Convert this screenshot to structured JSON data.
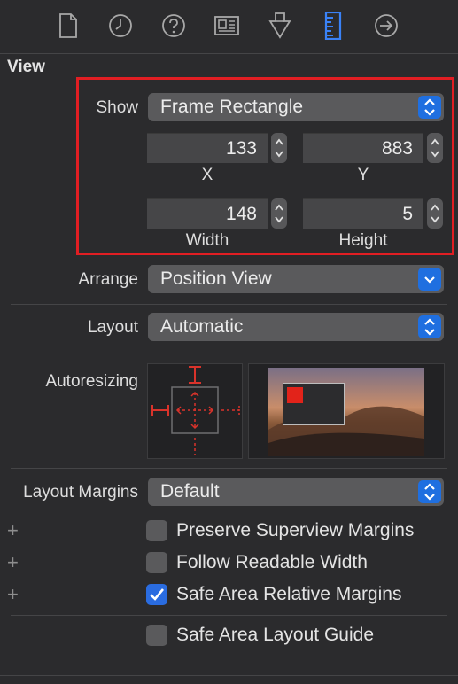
{
  "toolbar": {
    "icons": [
      "file-icon",
      "clock-icon",
      "help-icon",
      "identity-icon",
      "attributes-icon",
      "ruler-icon",
      "connections-icon"
    ],
    "active_color": "#3a82f7"
  },
  "section": {
    "title": "View"
  },
  "show": {
    "label": "Show",
    "value": "Frame Rectangle"
  },
  "frame": {
    "x": {
      "value": "133",
      "caption": "X"
    },
    "y": {
      "value": "883",
      "caption": "Y"
    },
    "width": {
      "value": "148",
      "caption": "Width"
    },
    "height": {
      "value": "5",
      "caption": "Height"
    }
  },
  "arrange": {
    "label": "Arrange",
    "value": "Position View"
  },
  "layout": {
    "label": "Layout",
    "value": "Automatic"
  },
  "autoresizing": {
    "label": "Autoresizing",
    "accent": "#d9332b"
  },
  "layout_margins": {
    "label": "Layout Margins",
    "value": "Default"
  },
  "options": [
    {
      "label": "Preserve Superview Margins",
      "checked": false
    },
    {
      "label": "Follow Readable Width",
      "checked": false
    },
    {
      "label": "Safe Area Relative Margins",
      "checked": true
    }
  ],
  "safe_area_guide": {
    "label": "Safe Area Layout Guide",
    "checked": false
  },
  "plus_symbol": "+",
  "highlight_color": "#e11e23"
}
